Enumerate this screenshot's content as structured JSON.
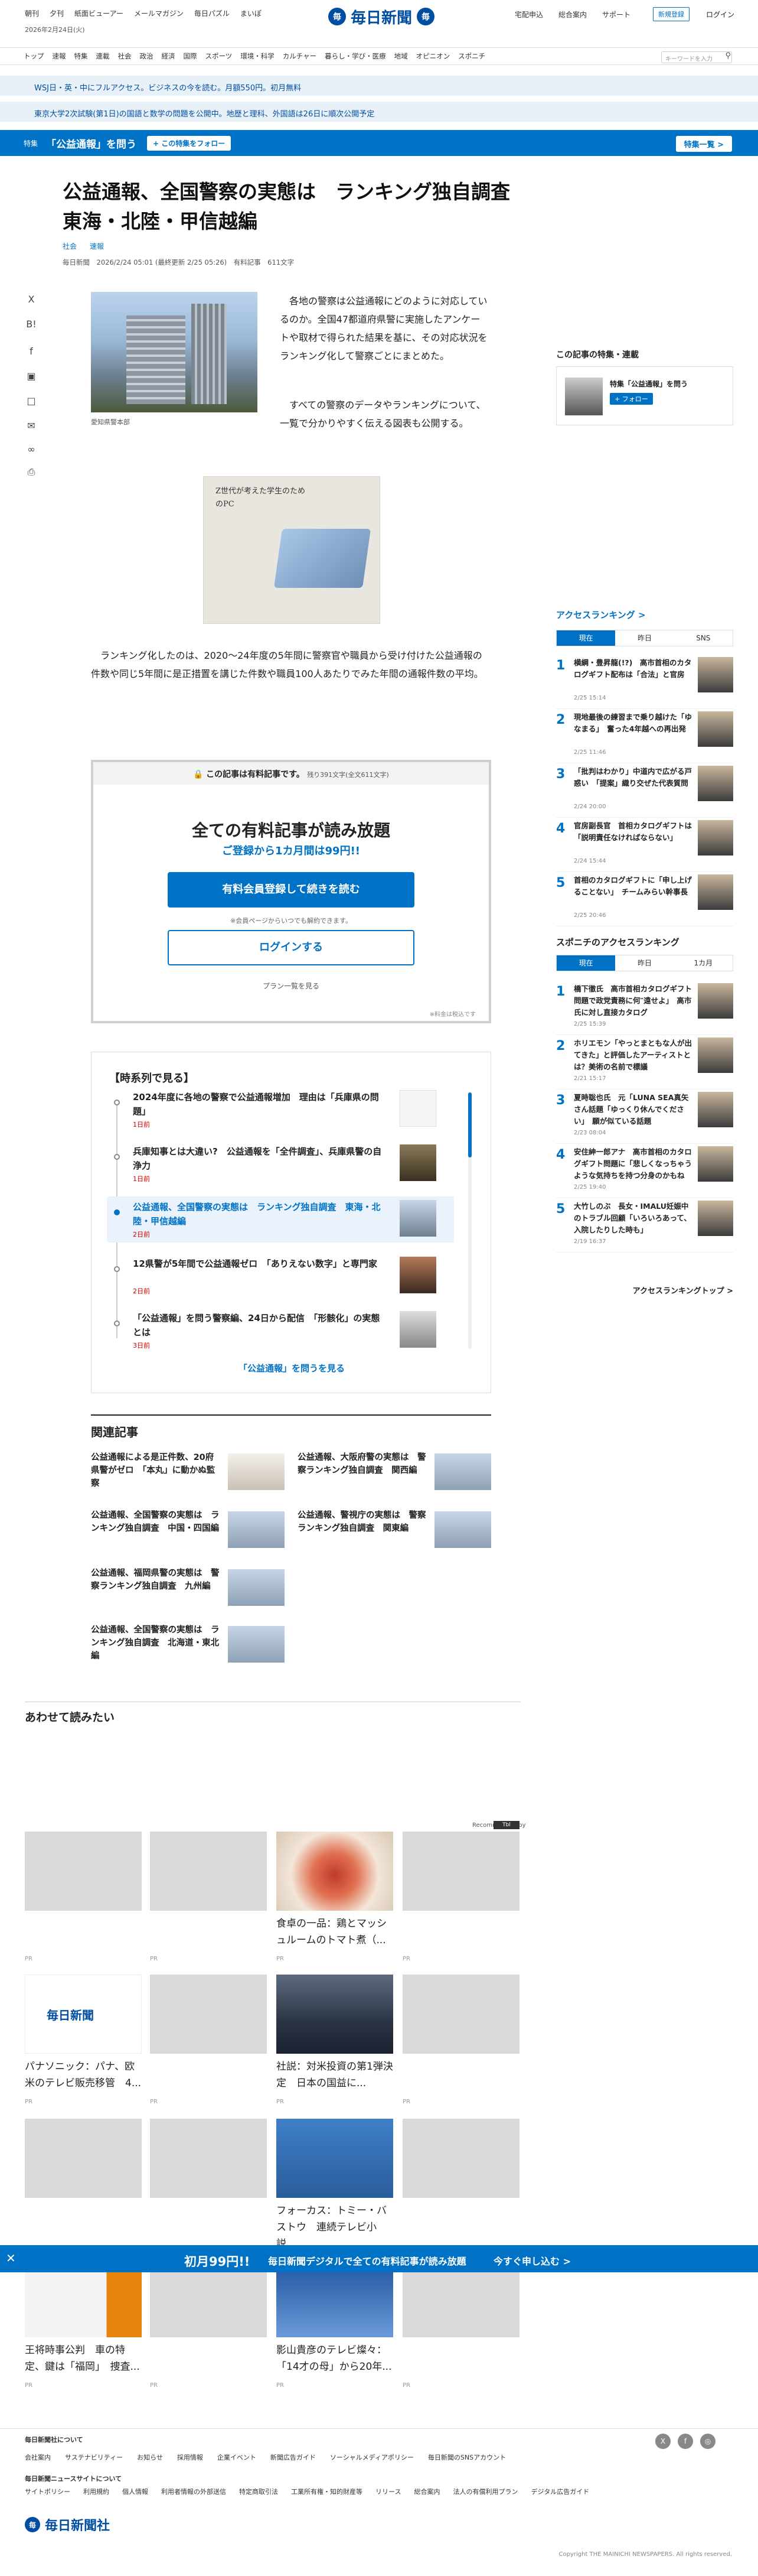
{
  "header": {
    "left_links": [
      "朝刊",
      "夕刊",
      "紙面ビューアー",
      "メールマガジン",
      "毎日パズル",
      "まいぽ"
    ],
    "date": "2026年2月24日(火)",
    "logo_text": "毎日新聞",
    "right_links": [
      "宅配申込",
      "総合案内",
      "サポート"
    ],
    "register_label": "新規登録",
    "login_label": "ログイン"
  },
  "nav": {
    "items": [
      "トップ",
      "速報",
      "特集",
      "連載",
      "社会",
      "政治",
      "経済",
      "国際",
      "スポーツ",
      "環境・科学",
      "カルチャー",
      "暮らし・学び・医療",
      "地域",
      "オピニオン",
      "スポニチ"
    ],
    "search_placeholder": "キーワードを入力"
  },
  "notices": [
    "WSJ日・英・中にフルアクセス。ビジネスの今を読む。月額550円。初月無料",
    "東京大学2次試験(第1日)の国語と数学の問題を公開中。地歴と理科、外国語は26日に順次公開予定"
  ],
  "feature": {
    "label": "特集",
    "title": "「公益通報」を問う",
    "follow_label": "+ この特集をフォロー",
    "all_label": "特集一覧 >"
  },
  "article": {
    "title": "公益通報、全国警察の実態は　ランキング独自調査　東海・北陸・甲信越編",
    "categories": [
      "社会",
      "速報"
    ],
    "meta": "毎日新聞　2026/2/24 05:01 (最終更新 2/25 05:26)　有料記事　611文字",
    "caption": "愛知県警本部",
    "para1": "各地の警察は公益通報にどのように対応しているのか。全国47都道府県警に実施したアンケートや取材で得られた結果を基に、その対応状況をランキング化して警察ごとにまとめた。",
    "para2": "すべての警察のデータやランキングについて、一覧で分かりやすく伝える図表も公開する。",
    "para3": "ランキング化したのは、2020〜24年度の5年間に警察官や職員から受け付けた公益通報の件数や同じ5年間に是正措置を講じた件数や職員100人あたりでみた年間の通報件数の平均。",
    "ad_text": "Z世代が考えた学生のためのPC"
  },
  "paywall": {
    "head": "この記事は有料記事です。",
    "remain": "残り391文字(全文611文字)",
    "title": "全ての有料記事が読み放題",
    "subtitle": "ご登録から1カ月間は99円!!",
    "register_button": "有料会員登録して続きを読む",
    "note": "※会員ページからいつでも解約できます。",
    "login_button": "ログインする",
    "plan_link": "プラン一覧を見る",
    "small": "※料金は税込です"
  },
  "timeline": {
    "title": "【時系列で見る】",
    "items": [
      {
        "headline": "2024年度に各地の警察で公益通報増加　理由は「兵庫県の問題」",
        "date": "1日前"
      },
      {
        "headline": "兵庫知事とは大違い?　公益通報を「全件調査」、兵庫県警の自浄力",
        "date": "1日前"
      },
      {
        "headline": "公益通報、全国警察の実態は　ランキング独自調査　東海・北陸・甲信越編",
        "date": "2日前"
      },
      {
        "headline": "12県警が5年間で公益通報ゼロ　「ありえない数字」と専門家",
        "date": "2日前"
      },
      {
        "headline": "「公益通報」を問う警察編、24日から配信　「形骸化」の実態とは",
        "date": "3日前"
      }
    ],
    "more": "「公益通報」を問うを見る"
  },
  "related": {
    "title": "関連記事",
    "items": [
      "公益通報による是正件数、20府県警がゼロ　「本丸」に動かぬ監察",
      "公益通報、大阪府警の実態は　警察ランキング独自調査　関西編",
      "公益通報、全国警察の実態は　ランキング独自調査　中国・四国編",
      "公益通報、警視庁の実態は　警察ランキング独自調査　関東編",
      "公益通報、福岡県警の実態は　警察ランキング独自調査　九州編",
      "公益通報、全国警察の実態は　ランキング独自調査　北海道・東北編"
    ]
  },
  "recommend": {
    "title": "あわせて読みたい",
    "recommended_by": "Recommended by",
    "cards": [
      {
        "text": "",
        "pr": "PR"
      },
      {
        "text": "",
        "pr": "PR"
      },
      {
        "text": "食卓の一品：鶏とマッシュルームのトマト煮（...",
        "pr": "PR"
      },
      {
        "text": "",
        "pr": "PR"
      },
      {
        "text": "パナソニック：パナ、欧米のテレビ販売移管　4...",
        "pr": "PR"
      },
      {
        "text": "",
        "pr": "PR"
      },
      {
        "text": "社説：対米投資の第1弾決定　日本の国益に...",
        "pr": "PR"
      },
      {
        "text": "",
        "pr": "PR"
      },
      {
        "text": "王将時事公判　車の特定、鍵は「福岡」　捜査...",
        "pr": "PR"
      },
      {
        "text": "",
        "pr": "PR"
      },
      {
        "text": "影山貴彦のテレビ燦々：「14才の母」から20年...",
        "pr": "PR"
      },
      {
        "text": "",
        "pr": "PR"
      }
    ],
    "mid_cards": [
      "フォーカス：トミー・バストウ　連続テレビ小説..."
    ]
  },
  "sidebar": {
    "feature_title": "この記事の特集・連載",
    "feature_name": "特集「公益通報」を問う",
    "feature_follow": "+ フォロー",
    "access_title": "アクセスランキング >",
    "access_tabs": [
      "現在",
      "昨日",
      "SNS"
    ],
    "access": [
      {
        "text": "横綱・豊昇龍(!?)　高市首相のカタログギフト配布は「合法」と官房",
        "date": "2/25 15:14"
      },
      {
        "text": "現地最後の練習まで乗り越けた「ゆなまる」　奮った4年越への再出発",
        "date": "2/25 11:46"
      },
      {
        "text": "「批判はわかり」中道内で広がる戸惑い　「提案」織り交ぜた代表質問",
        "date": "2/24 20:00"
      },
      {
        "text": "官房副長官　首相カタログギフトは「説明責任なければならない」",
        "date": "2/24 15:44"
      },
      {
        "text": "首相のカタログギフトに「申し上げることない」　チームみらい幹事長",
        "date": "2/25 20:46"
      }
    ],
    "sponichi_title": "スポニチのアクセスランキング",
    "sponichi_tabs": [
      "現在",
      "昨日",
      "1カ月"
    ],
    "sponichi": [
      {
        "text": "橋下徹氏　高市首相カタログギフト問題で政党責務に何″遠せよ」　高市氏に対し直接カタログ",
        "date": "2/25 15:39"
      },
      {
        "text": "ホリエモン「やっとまともな人が出てきた」と評価したアーティストとは？美術の名前で標議",
        "date": "2/21 15:17"
      },
      {
        "text": "夏時聡也氏　元「LUNA SEA真矢さん話題「ゆっくり休んでください」　願が似ている話題",
        "date": "2/23 08:04"
      },
      {
        "text": "安住紳一郎アナ　高市首相のカタログギフト問題に「悲しくなっちゃうような気持ちを持つ分身のかもね",
        "date": "2/25 19:40"
      },
      {
        "text": "大竹しのぶ　長女・IMALU妊娠中のトラブル回顧「いろいろあって、入院したりした時も」",
        "date": "2/19 16:37"
      }
    ],
    "sponichi_more": "アクセスランキングトップ >"
  },
  "banner": {
    "price": "初月99円!!",
    "text": "毎日新聞デジタルで全ての有料記事が読み放題",
    "cta": "今すぐ申し込む >"
  },
  "footer": {
    "about": "毎日新聞社について",
    "row1": [
      "会社案内",
      "サステナビリティー",
      "お知らせ",
      "採用情報",
      "企業イベント",
      "新聞広告ガイド",
      "ソーシャルメディアポリシー",
      "毎日新聞のSNSアカウント"
    ],
    "site": "毎日新聞ニュースサイトについて",
    "row2": [
      "サイトポリシー",
      "利用規約",
      "個人情報",
      "利用者情報の外部送信",
      "特定商取引法",
      "工業所有権・知的財産等",
      "リリース",
      "総合案内",
      "法人の有償利用プラン",
      "デジタル広告ガイド"
    ],
    "logo": "毎日新聞社",
    "copyright": "Copyright THE MAINICHI NEWSPAPERS. All rights reserved."
  }
}
